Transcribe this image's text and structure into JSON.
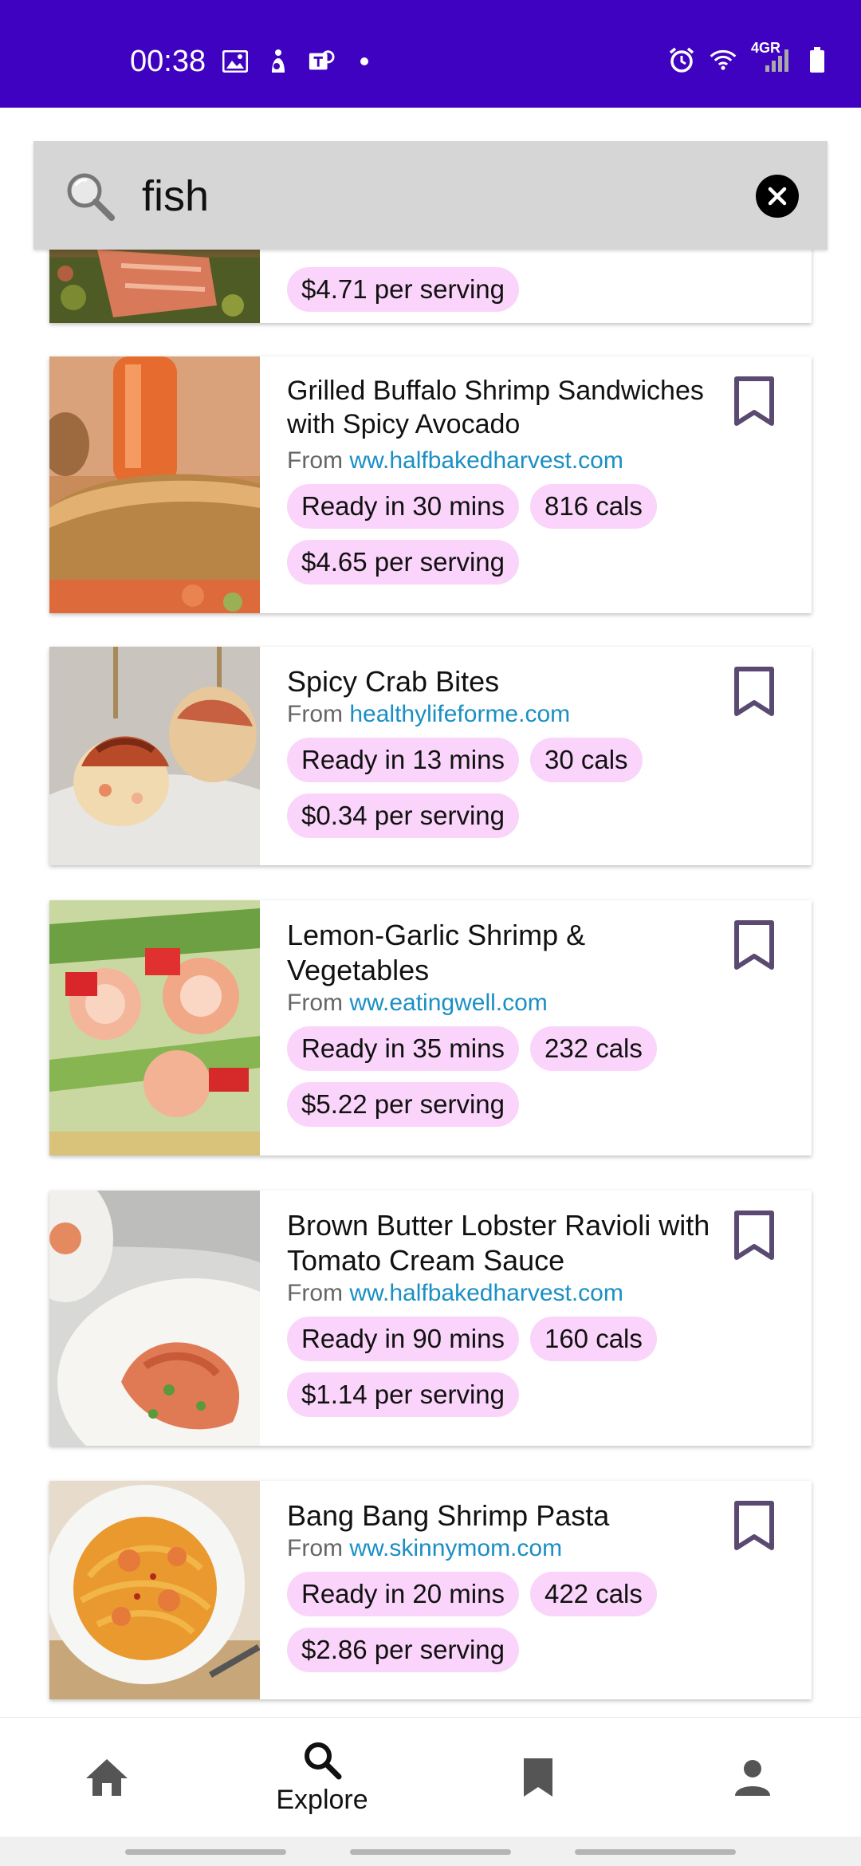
{
  "status_bar": {
    "time": "00:38",
    "network": "4GR",
    "bg_color": "#3f02c0",
    "left_icons": [
      "gallery-icon",
      "accessibility-icon",
      "teams-icon",
      "dot-icon"
    ],
    "right_icons": [
      "alarm-icon",
      "wifi-icon",
      "signal-icon",
      "battery-icon"
    ]
  },
  "search": {
    "query": "fish",
    "icon": "search-icon",
    "clear_icon": "close-icon"
  },
  "partial_card": {
    "chip_price": "$4.71 per serving"
  },
  "recipes": [
    {
      "title": "Grilled Buffalo Shrimp Sandwiches with Spicy Avocado",
      "source_prefix": "From",
      "source": "ww.halfbakedharvest.com",
      "ready": "Ready in 30 mins",
      "cals": "816 cals",
      "price": "$4.65 per serving"
    },
    {
      "title": "Spicy Crab Bites",
      "source_prefix": "From",
      "source": "healthylifeforme.com",
      "ready": "Ready in 13 mins",
      "cals": "30 cals",
      "price": "$0.34 per serving"
    },
    {
      "title": "Lemon-Garlic Shrimp & Vegetables",
      "source_prefix": "From",
      "source": "ww.eatingwell.com",
      "ready": "Ready in 35 mins",
      "cals": "232 cals",
      "price": "$5.22 per serving"
    },
    {
      "title": "Brown Butter Lobster Ravioli with Tomato Cream Sauce",
      "source_prefix": "From",
      "source": "ww.halfbakedharvest.com",
      "ready": "Ready in 90 mins",
      "cals": "160 cals",
      "price": "$1.14 per serving"
    },
    {
      "title": "Bang Bang Shrimp Pasta",
      "source_prefix": "From",
      "source": "ww.skinnymom.com",
      "ready": "Ready in 20 mins",
      "cals": "422 cals",
      "price": "$2.86 per serving"
    }
  ],
  "nav": {
    "explore_label": "Explore",
    "items": [
      "home-icon",
      "search-icon",
      "bookmark-icon",
      "profile-icon"
    ]
  },
  "colors": {
    "chip_bg": "#fad4fa",
    "link": "#1a8fc4",
    "bookmark": "#5a4a72"
  }
}
